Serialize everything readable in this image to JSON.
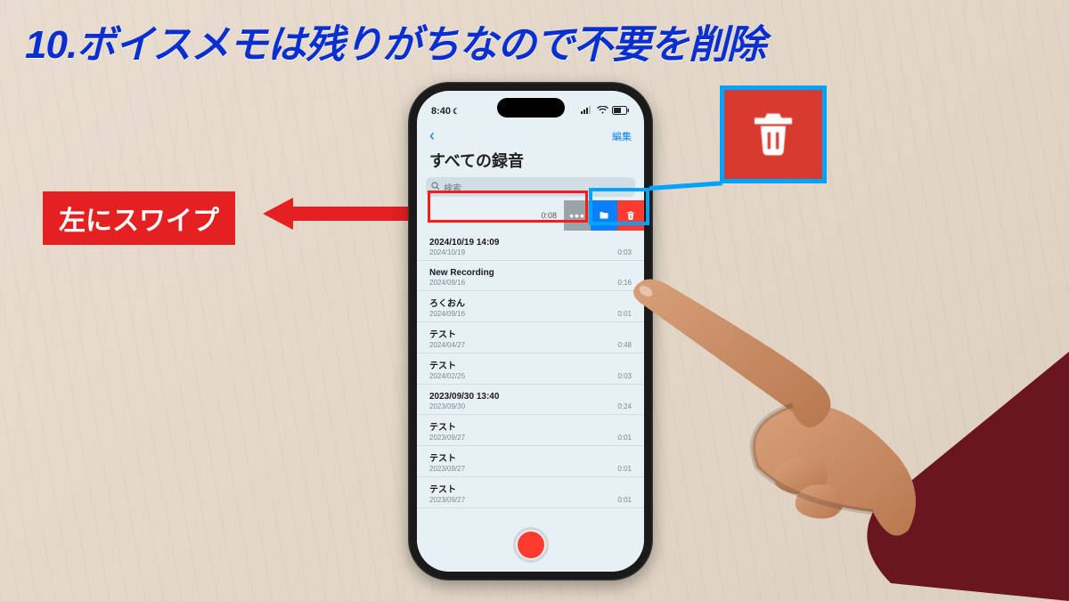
{
  "headline": "10.ボイスメモは残りがちなので不要を削除",
  "swipe_label": "左にスワイプ",
  "colors": {
    "accent_blue": "#0a2fd0",
    "highlight_cyan": "#00a3ff",
    "danger_red": "#e52020",
    "ios_blue": "#0a7fff",
    "ios_red": "#ff3b30"
  },
  "phone": {
    "status": {
      "time": "8:40",
      "dnd_icon": "moon"
    },
    "nav": {
      "back_icon": "chevron-left",
      "edit_label": "編集"
    },
    "title": "すべての録音",
    "search": {
      "placeholder": "検索",
      "icon": "magnifying-glass"
    },
    "swiped_row": {
      "duration": "0:08",
      "actions": {
        "more_icon": "ellipsis",
        "folder_icon": "folder",
        "trash_icon": "trash"
      }
    },
    "recordings": [
      {
        "title": "2024/10/19 14:09",
        "date": "2024/10/19",
        "duration": "0:03"
      },
      {
        "title": "New Recording",
        "date": "2024/09/16",
        "duration": "0:16"
      },
      {
        "title": "ろくおん",
        "date": "2024/09/16",
        "duration": "0:01"
      },
      {
        "title": "テスト",
        "date": "2024/04/27",
        "duration": "0:48"
      },
      {
        "title": "テスト",
        "date": "2024/02/25",
        "duration": "0:03"
      },
      {
        "title": "2023/09/30 13:40",
        "date": "2023/09/30",
        "duration": "0:24"
      },
      {
        "title": "テスト",
        "date": "2023/09/27",
        "duration": "0:01"
      },
      {
        "title": "テスト",
        "date": "2023/09/27",
        "duration": "0:01"
      },
      {
        "title": "テスト",
        "date": "2023/09/27",
        "duration": "0:01"
      }
    ],
    "record_button_icon": "record"
  },
  "callout_icon": "trash"
}
